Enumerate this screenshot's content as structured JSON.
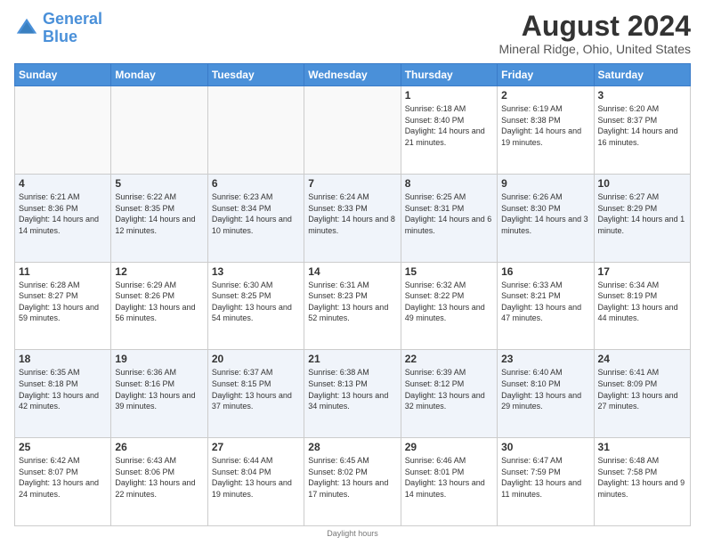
{
  "header": {
    "logo_line1": "General",
    "logo_line2": "Blue",
    "title": "August 2024",
    "subtitle": "Mineral Ridge, Ohio, United States"
  },
  "weekdays": [
    "Sunday",
    "Monday",
    "Tuesday",
    "Wednesday",
    "Thursday",
    "Friday",
    "Saturday"
  ],
  "weeks": [
    [
      {
        "day": "",
        "sunrise": "",
        "sunset": "",
        "daylight": ""
      },
      {
        "day": "",
        "sunrise": "",
        "sunset": "",
        "daylight": ""
      },
      {
        "day": "",
        "sunrise": "",
        "sunset": "",
        "daylight": ""
      },
      {
        "day": "",
        "sunrise": "",
        "sunset": "",
        "daylight": ""
      },
      {
        "day": "1",
        "sunrise": "Sunrise: 6:18 AM",
        "sunset": "Sunset: 8:40 PM",
        "daylight": "Daylight: 14 hours and 21 minutes."
      },
      {
        "day": "2",
        "sunrise": "Sunrise: 6:19 AM",
        "sunset": "Sunset: 8:38 PM",
        "daylight": "Daylight: 14 hours and 19 minutes."
      },
      {
        "day": "3",
        "sunrise": "Sunrise: 6:20 AM",
        "sunset": "Sunset: 8:37 PM",
        "daylight": "Daylight: 14 hours and 16 minutes."
      }
    ],
    [
      {
        "day": "4",
        "sunrise": "Sunrise: 6:21 AM",
        "sunset": "Sunset: 8:36 PM",
        "daylight": "Daylight: 14 hours and 14 minutes."
      },
      {
        "day": "5",
        "sunrise": "Sunrise: 6:22 AM",
        "sunset": "Sunset: 8:35 PM",
        "daylight": "Daylight: 14 hours and 12 minutes."
      },
      {
        "day": "6",
        "sunrise": "Sunrise: 6:23 AM",
        "sunset": "Sunset: 8:34 PM",
        "daylight": "Daylight: 14 hours and 10 minutes."
      },
      {
        "day": "7",
        "sunrise": "Sunrise: 6:24 AM",
        "sunset": "Sunset: 8:33 PM",
        "daylight": "Daylight: 14 hours and 8 minutes."
      },
      {
        "day": "8",
        "sunrise": "Sunrise: 6:25 AM",
        "sunset": "Sunset: 8:31 PM",
        "daylight": "Daylight: 14 hours and 6 minutes."
      },
      {
        "day": "9",
        "sunrise": "Sunrise: 6:26 AM",
        "sunset": "Sunset: 8:30 PM",
        "daylight": "Daylight: 14 hours and 3 minutes."
      },
      {
        "day": "10",
        "sunrise": "Sunrise: 6:27 AM",
        "sunset": "Sunset: 8:29 PM",
        "daylight": "Daylight: 14 hours and 1 minute."
      }
    ],
    [
      {
        "day": "11",
        "sunrise": "Sunrise: 6:28 AM",
        "sunset": "Sunset: 8:27 PM",
        "daylight": "Daylight: 13 hours and 59 minutes."
      },
      {
        "day": "12",
        "sunrise": "Sunrise: 6:29 AM",
        "sunset": "Sunset: 8:26 PM",
        "daylight": "Daylight: 13 hours and 56 minutes."
      },
      {
        "day": "13",
        "sunrise": "Sunrise: 6:30 AM",
        "sunset": "Sunset: 8:25 PM",
        "daylight": "Daylight: 13 hours and 54 minutes."
      },
      {
        "day": "14",
        "sunrise": "Sunrise: 6:31 AM",
        "sunset": "Sunset: 8:23 PM",
        "daylight": "Daylight: 13 hours and 52 minutes."
      },
      {
        "day": "15",
        "sunrise": "Sunrise: 6:32 AM",
        "sunset": "Sunset: 8:22 PM",
        "daylight": "Daylight: 13 hours and 49 minutes."
      },
      {
        "day": "16",
        "sunrise": "Sunrise: 6:33 AM",
        "sunset": "Sunset: 8:21 PM",
        "daylight": "Daylight: 13 hours and 47 minutes."
      },
      {
        "day": "17",
        "sunrise": "Sunrise: 6:34 AM",
        "sunset": "Sunset: 8:19 PM",
        "daylight": "Daylight: 13 hours and 44 minutes."
      }
    ],
    [
      {
        "day": "18",
        "sunrise": "Sunrise: 6:35 AM",
        "sunset": "Sunset: 8:18 PM",
        "daylight": "Daylight: 13 hours and 42 minutes."
      },
      {
        "day": "19",
        "sunrise": "Sunrise: 6:36 AM",
        "sunset": "Sunset: 8:16 PM",
        "daylight": "Daylight: 13 hours and 39 minutes."
      },
      {
        "day": "20",
        "sunrise": "Sunrise: 6:37 AM",
        "sunset": "Sunset: 8:15 PM",
        "daylight": "Daylight: 13 hours and 37 minutes."
      },
      {
        "day": "21",
        "sunrise": "Sunrise: 6:38 AM",
        "sunset": "Sunset: 8:13 PM",
        "daylight": "Daylight: 13 hours and 34 minutes."
      },
      {
        "day": "22",
        "sunrise": "Sunrise: 6:39 AM",
        "sunset": "Sunset: 8:12 PM",
        "daylight": "Daylight: 13 hours and 32 minutes."
      },
      {
        "day": "23",
        "sunrise": "Sunrise: 6:40 AM",
        "sunset": "Sunset: 8:10 PM",
        "daylight": "Daylight: 13 hours and 29 minutes."
      },
      {
        "day": "24",
        "sunrise": "Sunrise: 6:41 AM",
        "sunset": "Sunset: 8:09 PM",
        "daylight": "Daylight: 13 hours and 27 minutes."
      }
    ],
    [
      {
        "day": "25",
        "sunrise": "Sunrise: 6:42 AM",
        "sunset": "Sunset: 8:07 PM",
        "daylight": "Daylight: 13 hours and 24 minutes."
      },
      {
        "day": "26",
        "sunrise": "Sunrise: 6:43 AM",
        "sunset": "Sunset: 8:06 PM",
        "daylight": "Daylight: 13 hours and 22 minutes."
      },
      {
        "day": "27",
        "sunrise": "Sunrise: 6:44 AM",
        "sunset": "Sunset: 8:04 PM",
        "daylight": "Daylight: 13 hours and 19 minutes."
      },
      {
        "day": "28",
        "sunrise": "Sunrise: 6:45 AM",
        "sunset": "Sunset: 8:02 PM",
        "daylight": "Daylight: 13 hours and 17 minutes."
      },
      {
        "day": "29",
        "sunrise": "Sunrise: 6:46 AM",
        "sunset": "Sunset: 8:01 PM",
        "daylight": "Daylight: 13 hours and 14 minutes."
      },
      {
        "day": "30",
        "sunrise": "Sunrise: 6:47 AM",
        "sunset": "Sunset: 7:59 PM",
        "daylight": "Daylight: 13 hours and 11 minutes."
      },
      {
        "day": "31",
        "sunrise": "Sunrise: 6:48 AM",
        "sunset": "Sunset: 7:58 PM",
        "daylight": "Daylight: 13 hours and 9 minutes."
      }
    ]
  ],
  "footer": {
    "daylight_hours": "Daylight hours"
  }
}
